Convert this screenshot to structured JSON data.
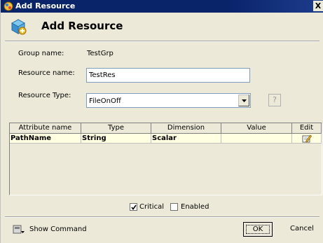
{
  "window": {
    "title": "Add Resource",
    "close_label": "X",
    "header_title": "Add Resource"
  },
  "form": {
    "group_name_label": "Group name:",
    "group_name_value": "TestGrp",
    "resource_name_label": "Resource name:",
    "resource_name_value": "TestRes",
    "resource_type_label": "Resource Type:",
    "resource_type_value": "FileOnOff",
    "help_label": "?"
  },
  "table": {
    "columns": [
      "Attribute name",
      "Type",
      "Dimension",
      "Value",
      "Edit"
    ],
    "rows": [
      {
        "attribute_name": "PathName",
        "type": "String",
        "dimension": "Scalar",
        "value": "",
        "edit_icon": "edit-icon"
      }
    ]
  },
  "options": {
    "critical_label": "Critical",
    "critical_checked": true,
    "enabled_label": "Enabled",
    "enabled_checked": false
  },
  "footer": {
    "show_command_label": "Show Command",
    "ok_label": "OK",
    "cancel_label": "Cancel"
  },
  "colors": {
    "titlebar": "#0a246a",
    "dialog_bg": "#ece9d8",
    "row_highlight": "#ffffe1"
  }
}
